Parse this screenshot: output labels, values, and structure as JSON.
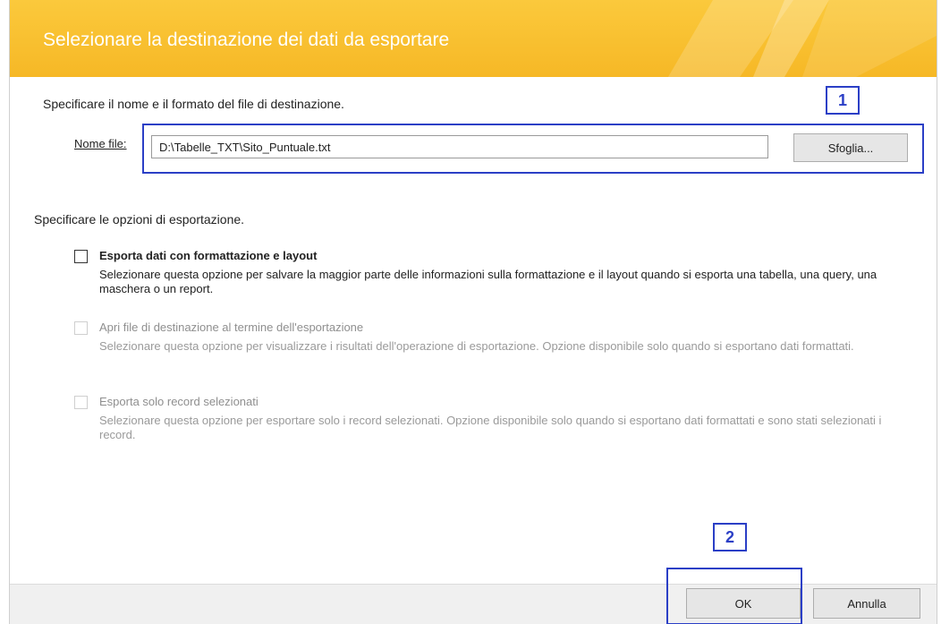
{
  "dialog": {
    "title": "Selezionare la destinazione dei dati da esportare"
  },
  "file_section": {
    "instruction": "Specificare il nome e il formato del file di destinazione.",
    "filename_label": "Nome file:",
    "filename_value": "D:\\Tabelle_TXT\\Sito_Puntuale.txt",
    "browse_label": "Sfoglia..."
  },
  "options_section": {
    "instruction": "Specificare le opzioni di esportazione.",
    "options": [
      {
        "title": "Esporta dati con formattazione e layout",
        "description": "Selezionare questa opzione per salvare la maggior parte delle informazioni sulla formattazione e il layout quando si esporta una tabella, una query, una maschera o un report.",
        "checked": false,
        "enabled": true
      },
      {
        "title": "Apri file di destinazione al termine dell'esportazione",
        "description": "Selezionare questa opzione per visualizzare i risultati dell'operazione di esportazione. Opzione disponibile solo quando si esportano dati formattati.",
        "checked": false,
        "enabled": false
      },
      {
        "title": "Esporta solo record selezionati",
        "description": "Selezionare questa opzione per esportare solo i record selezionati. Opzione disponibile solo quando si esportano dati formattati e sono stati selezionati i record.",
        "checked": false,
        "enabled": false
      }
    ]
  },
  "footer": {
    "ok_label": "OK",
    "cancel_label": "Annulla"
  },
  "annotations": {
    "marker_1": "1",
    "marker_2": "2"
  },
  "colors": {
    "header": "#f6b826",
    "annotation": "#2b3fc6"
  }
}
